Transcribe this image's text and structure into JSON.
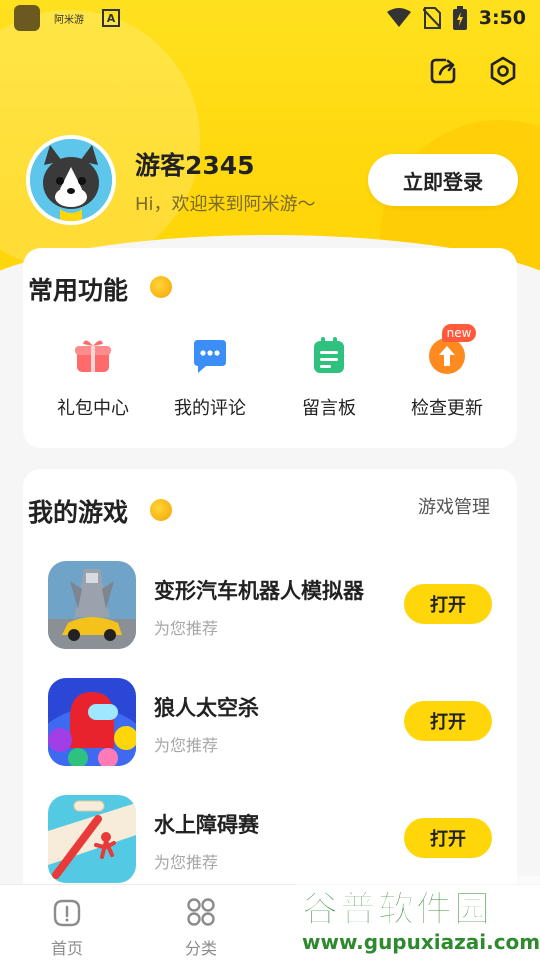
{
  "status_bar": {
    "app_label": "阿米游",
    "badge": "A",
    "time": "3:50"
  },
  "profile": {
    "username": "游客2345",
    "greeting": "Hi，欢迎来到阿米游～",
    "login_label": "立即登录"
  },
  "functions": {
    "title": "常用功能",
    "items": [
      {
        "label": "礼包中心",
        "icon": "gift-icon",
        "color": "#ff6b6b"
      },
      {
        "label": "我的评论",
        "icon": "comment-icon",
        "color": "#3a8ef6"
      },
      {
        "label": "留言板",
        "icon": "message-board-icon",
        "color": "#2ec27e"
      },
      {
        "label": "检查更新",
        "icon": "update-icon",
        "color": "#ff8a1f",
        "badge": "new"
      }
    ]
  },
  "my_games": {
    "title": "我的游戏",
    "manage_label": "游戏管理",
    "games": [
      {
        "name": "变形汽车机器人模拟器",
        "subtitle": "为您推荐",
        "button": "打开"
      },
      {
        "name": "狼人太空杀",
        "subtitle": "为您推荐",
        "button": "打开"
      },
      {
        "name": "水上障碍赛",
        "subtitle": "为您推荐",
        "button": "打开"
      }
    ]
  },
  "tabbar": {
    "tabs": [
      {
        "label": "首页"
      },
      {
        "label": "分类"
      }
    ]
  },
  "watermark": {
    "title": "谷普软件园",
    "url": "www.gupuxiazai.com"
  },
  "colors": {
    "brand_yellow": "#ffd60a",
    "accent_orange": "#f5a300"
  }
}
